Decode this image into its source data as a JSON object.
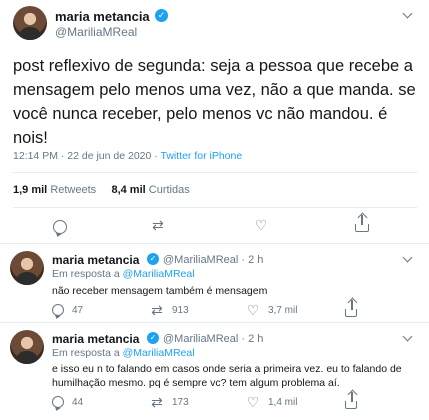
{
  "main_tweet": {
    "name": "maria metancia",
    "handle": "@MariliaMReal",
    "text": "post reflexivo de segunda: seja a pessoa que recebe a mensagem pelo menos uma vez, não a que manda. se você nunca receber, pelo menos vc não mandou. é nois!",
    "time": "12:14 PM · 22 de jun de 2020 · ",
    "source": "Twitter for iPhone",
    "retweets_count": "1,9 mil",
    "retweets_label": "Retweets",
    "likes_count": "8,4 mil",
    "likes_label": "Curtidas"
  },
  "replies": [
    {
      "name": "maria metancia",
      "handle": "@MariliaMReal · 2 h",
      "in_reply_prefix": "Em resposta a ",
      "in_reply_handle": "@MariliaMReal",
      "text": "não receber mensagem também é mensagem",
      "reply_count": "47",
      "retweet_count": "913",
      "like_count": "3,7 mil"
    },
    {
      "name": "maria metancia",
      "handle": "@MariliaMReal · 2 h",
      "in_reply_prefix": "Em resposta a ",
      "in_reply_handle": "@MariliaMReal",
      "text": "e isso eu n to falando em casos onde seria a primeira vez. eu to falando de humilhação mesmo. pq é sempre vc? tem algum problema aí.",
      "reply_count": "44",
      "retweet_count": "173",
      "like_count": "1,4 mil"
    }
  ],
  "icons": {
    "verified": "✓",
    "retweet": "⇄",
    "like": "♡"
  },
  "colors": {
    "accent": "#1da1f2",
    "secondary_text": "#657786",
    "divider": "#e6ecf0"
  }
}
